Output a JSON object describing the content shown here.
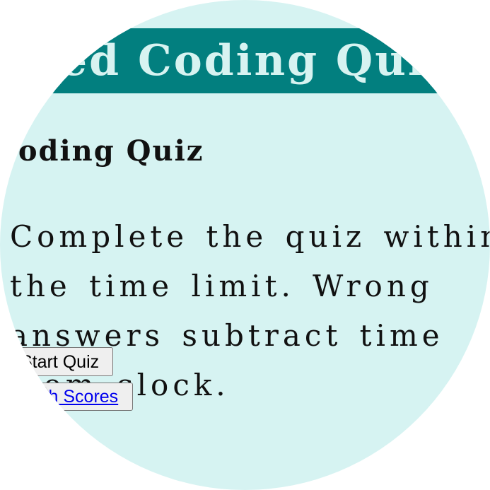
{
  "header": {
    "title": "Timed Coding Quiz"
  },
  "main": {
    "heading": "Coding Quiz",
    "intro": "Complete the quiz within the time limit. Wrong answers subtract time from clock.",
    "start_button_label": "Start Quiz",
    "highscores_link_label": "High Scores"
  }
}
